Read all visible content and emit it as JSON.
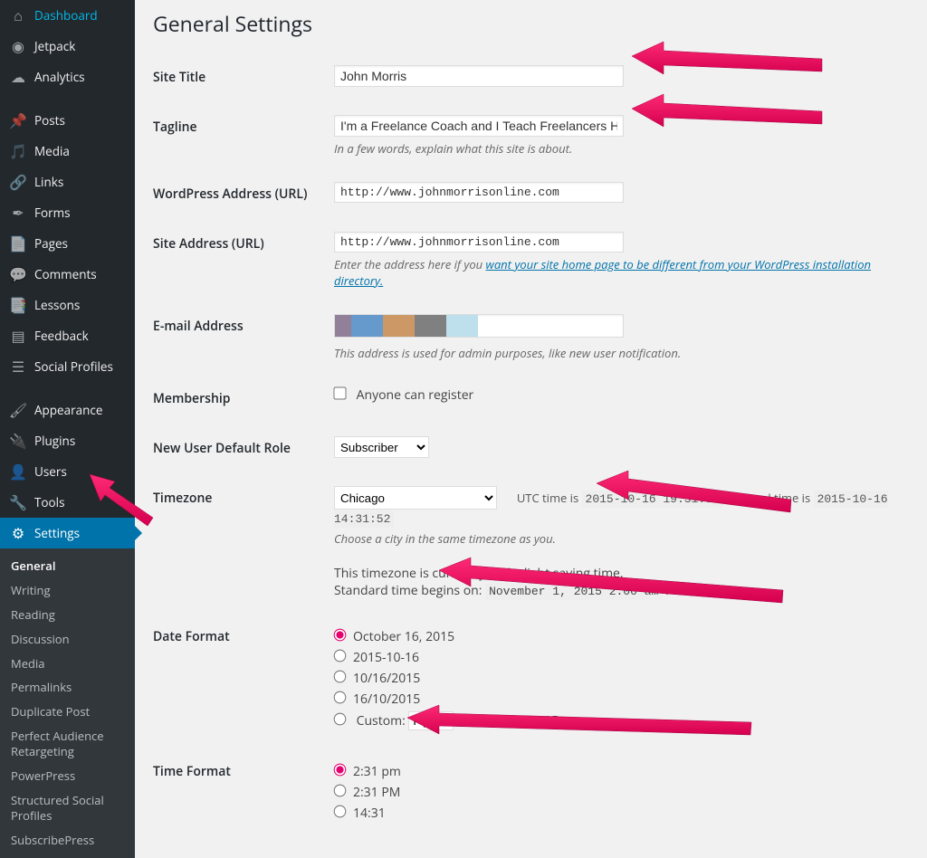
{
  "sidebar": {
    "items": [
      {
        "label": "Dashboard",
        "icon": "dashboard"
      },
      {
        "label": "Jetpack",
        "icon": "jetpack"
      },
      {
        "label": "Analytics",
        "icon": "analytics"
      },
      {
        "label": "Posts",
        "icon": "pin"
      },
      {
        "label": "Media",
        "icon": "media"
      },
      {
        "label": "Links",
        "icon": "link"
      },
      {
        "label": "Forms",
        "icon": "forms"
      },
      {
        "label": "Pages",
        "icon": "page"
      },
      {
        "label": "Comments",
        "icon": "comments"
      },
      {
        "label": "Lessons",
        "icon": "lessons"
      },
      {
        "label": "Feedback",
        "icon": "feedback"
      },
      {
        "label": "Social Profiles",
        "icon": "social"
      },
      {
        "label": "Appearance",
        "icon": "appearance"
      },
      {
        "label": "Plugins",
        "icon": "plugins"
      },
      {
        "label": "Users",
        "icon": "users"
      },
      {
        "label": "Tools",
        "icon": "tools"
      },
      {
        "label": "Settings",
        "icon": "settings"
      }
    ],
    "submenu": [
      "General",
      "Writing",
      "Reading",
      "Discussion",
      "Media",
      "Permalinks",
      "Duplicate Post",
      "Perfect Audience Retargeting",
      "PowerPress",
      "Structured Social Profiles",
      "SubscribePress"
    ]
  },
  "page": {
    "title": "General Settings",
    "fields": {
      "site_title": {
        "label": "Site Title",
        "value": "John Morris"
      },
      "tagline": {
        "label": "Tagline",
        "value": "I'm a Freelance Coach and I Teach Freelancers How",
        "desc": "In a few words, explain what this site is about."
      },
      "wp_url": {
        "label": "WordPress Address (URL)",
        "value": "http://www.johnmorrisonline.com"
      },
      "site_url": {
        "label": "Site Address (URL)",
        "value": "http://www.johnmorrisonline.com",
        "desc_prefix": "Enter the address here if you ",
        "desc_link": "want your site home page to be different from your WordPress installation directory."
      },
      "email": {
        "label": "E-mail Address",
        "desc": "This address is used for admin purposes, like new user notification."
      },
      "membership": {
        "label": "Membership",
        "checkbox_label": "Anyone can register"
      },
      "default_role": {
        "label": "New User Default Role",
        "value": "Subscriber"
      },
      "timezone": {
        "label": "Timezone",
        "value": "Chicago",
        "utc_label": "UTC time is",
        "utc_value": "2015-10-16 19:31:52",
        "local_label": "Local time is",
        "local_value": "2015-10-16 14:31:52",
        "desc": "Choose a city in the same timezone as you.",
        "dst_line1": "This timezone is currently in daylight saving time.",
        "dst_line2_prefix": "Standard time begins on: ",
        "dst_line2_value": "November 1, 2015 2:00 am"
      },
      "date_format": {
        "label": "Date Format",
        "options": [
          "October 16, 2015",
          "2015-10-16",
          "10/16/2015",
          "16/10/2015"
        ],
        "custom_label": "Custom:",
        "custom_value": "F j, Y",
        "custom_example": "October 16, 2015",
        "selected": 0
      },
      "time_format": {
        "label": "Time Format",
        "options": [
          "2:31 pm",
          "2:31 PM",
          "14:31"
        ],
        "selected": 0
      }
    }
  }
}
